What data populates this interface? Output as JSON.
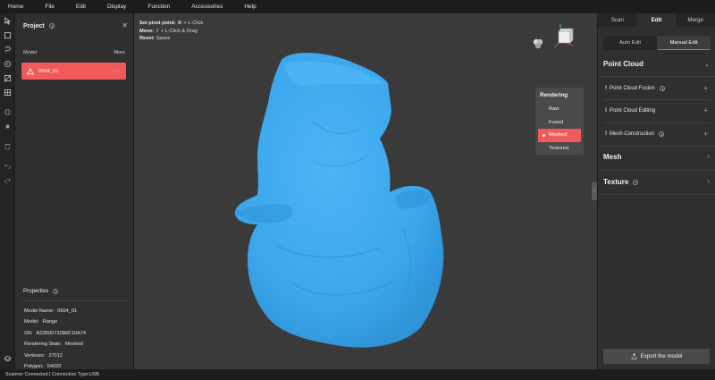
{
  "menu": [
    "Home",
    "File",
    "Edit",
    "Display",
    "Function",
    "Accessories",
    "Help"
  ],
  "tools": [
    "select-arrow-icon",
    "box-select-icon",
    "lasso-icon",
    "brush-select-icon",
    "invert-select-icon",
    "grid-select-icon",
    "globe-icon",
    "stop-icon",
    "delete-icon",
    "undo-icon",
    "redo-icon",
    "layers-icon"
  ],
  "left_panel": {
    "title": "Project",
    "close": "✕",
    "model_label": "Model",
    "more_label": "More",
    "models": [
      {
        "name": "0504_01",
        "menu": "···"
      }
    ],
    "properties_title": "Properties",
    "properties": [
      {
        "key": "Model Name:",
        "value": "0504_01"
      },
      {
        "key": "Model:",
        "value": "Range"
      },
      {
        "key": "SN:",
        "value": "A22B00732B6F10A74"
      },
      {
        "key": "Rendering State:",
        "value": "Meshed"
      },
      {
        "key": "Vertexes:",
        "value": "27012"
      },
      {
        "key": "Polygon:",
        "value": "54020"
      }
    ]
  },
  "viewport": {
    "hints": [
      {
        "label": "Set pivot point:",
        "value": " ⌘ + L-Click"
      },
      {
        "label": "Move:",
        "value": " ⇧ + L-Click & Drag"
      },
      {
        "label": "Reset:",
        "value": " Space"
      }
    ],
    "rendering": {
      "title": "Rendering",
      "options": [
        "Raw",
        "Fused",
        "Meshed",
        "Textured"
      ],
      "selected": "Meshed"
    },
    "collapse_glyph": "‹",
    "mesh_color": "#3ba8ef"
  },
  "right_panel": {
    "tabs": [
      "Scan",
      "Edit",
      "Merge"
    ],
    "active_tab": "Edit",
    "modes": [
      "Auto Edit",
      "Manual Edit"
    ],
    "active_mode": "Manual Edit",
    "sections": {
      "point_cloud": {
        "label": "Point Cloud",
        "chevron": "⌄"
      },
      "mesh": {
        "label": "Mesh",
        "chevron": "›"
      },
      "texture": {
        "label": "Texture",
        "chevron": "›"
      }
    },
    "point_cloud_items": [
      {
        "label": "Point Cloud Fusion",
        "warn": "!",
        "plus": "+"
      },
      {
        "label": "Point Cloud Editing",
        "warn": "!",
        "plus": "+"
      },
      {
        "label": "Mesh Construction",
        "warn": "!",
        "plus": "+"
      }
    ],
    "export_label": "Export the model"
  },
  "status": "Scanner Connected | Connection Type:USB",
  "colors": {
    "accent": "#f05a5a",
    "mesh": "#3ba8ef",
    "background": "#3a3a3a"
  }
}
